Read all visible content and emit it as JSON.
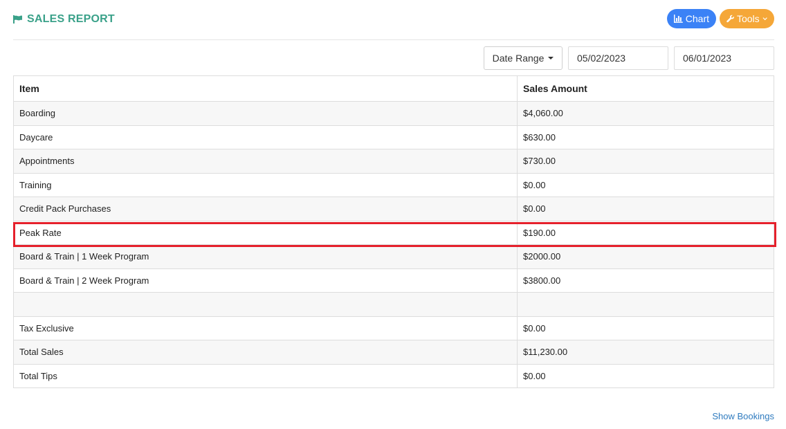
{
  "header": {
    "title": "SALES REPORT",
    "chart_label": "Chart",
    "tools_label": "Tools"
  },
  "filters": {
    "date_range_label": "Date Range",
    "start_date": "05/02/2023",
    "end_date": "06/01/2023"
  },
  "table": {
    "columns": [
      "Item",
      "Sales Amount"
    ],
    "rows": [
      {
        "item": "Boarding",
        "amount": "$4,060.00"
      },
      {
        "item": "Daycare",
        "amount": "$630.00"
      },
      {
        "item": "Appointments",
        "amount": "$730.00"
      },
      {
        "item": "Training",
        "amount": "$0.00"
      },
      {
        "item": "Credit Pack Purchases",
        "amount": "$0.00"
      },
      {
        "item": "Peak Rate",
        "amount": "$190.00"
      },
      {
        "item": "Board & Train | 1 Week Program",
        "amount": "$2000.00"
      },
      {
        "item": "Board & Train | 2 Week Program",
        "amount": "$3800.00"
      },
      {
        "item": "",
        "amount": ""
      },
      {
        "item": "Tax Exclusive",
        "amount": "$0.00"
      },
      {
        "item": "Total Sales",
        "amount": "$11,230.00"
      },
      {
        "item": "Total Tips",
        "amount": "$0.00"
      }
    ]
  },
  "footer": {
    "show_bookings_label": "Show Bookings"
  },
  "colors": {
    "title_green": "#3aa189",
    "chart_blue": "#3b82f6",
    "tools_orange": "#f5a738",
    "highlight_red": "#e5202b",
    "link_blue": "#2f7bbf"
  },
  "icons": {
    "title": "flag-icon",
    "chart": "bar-chart-icon",
    "tools": "wrench-icon",
    "tools_dropdown": "chevron-down-icon",
    "date_range_dropdown": "caret-down-icon"
  }
}
